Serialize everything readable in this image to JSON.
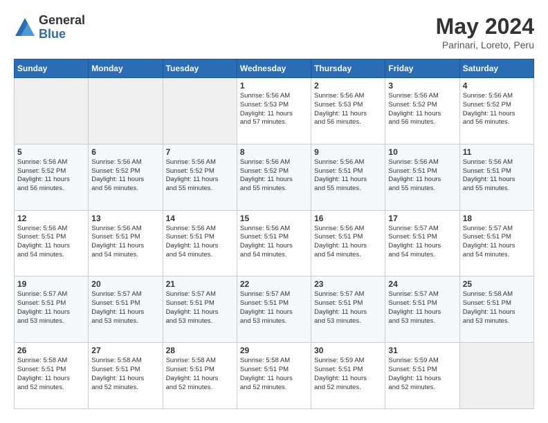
{
  "header": {
    "logo": {
      "general": "General",
      "blue": "Blue"
    },
    "title": "May 2024",
    "location": "Parinari, Loreto, Peru"
  },
  "days_of_week": [
    "Sunday",
    "Monday",
    "Tuesday",
    "Wednesday",
    "Thursday",
    "Friday",
    "Saturday"
  ],
  "weeks": [
    [
      {
        "day": "",
        "content": ""
      },
      {
        "day": "",
        "content": ""
      },
      {
        "day": "",
        "content": ""
      },
      {
        "day": "1",
        "content": "Sunrise: 5:56 AM\nSunset: 5:53 PM\nDaylight: 11 hours\nand 57 minutes."
      },
      {
        "day": "2",
        "content": "Sunrise: 5:56 AM\nSunset: 5:53 PM\nDaylight: 11 hours\nand 56 minutes."
      },
      {
        "day": "3",
        "content": "Sunrise: 5:56 AM\nSunset: 5:52 PM\nDaylight: 11 hours\nand 56 minutes."
      },
      {
        "day": "4",
        "content": "Sunrise: 5:56 AM\nSunset: 5:52 PM\nDaylight: 11 hours\nand 56 minutes."
      }
    ],
    [
      {
        "day": "5",
        "content": "Sunrise: 5:56 AM\nSunset: 5:52 PM\nDaylight: 11 hours\nand 56 minutes."
      },
      {
        "day": "6",
        "content": "Sunrise: 5:56 AM\nSunset: 5:52 PM\nDaylight: 11 hours\nand 56 minutes."
      },
      {
        "day": "7",
        "content": "Sunrise: 5:56 AM\nSunset: 5:52 PM\nDaylight: 11 hours\nand 55 minutes."
      },
      {
        "day": "8",
        "content": "Sunrise: 5:56 AM\nSunset: 5:52 PM\nDaylight: 11 hours\nand 55 minutes."
      },
      {
        "day": "9",
        "content": "Sunrise: 5:56 AM\nSunset: 5:51 PM\nDaylight: 11 hours\nand 55 minutes."
      },
      {
        "day": "10",
        "content": "Sunrise: 5:56 AM\nSunset: 5:51 PM\nDaylight: 11 hours\nand 55 minutes."
      },
      {
        "day": "11",
        "content": "Sunrise: 5:56 AM\nSunset: 5:51 PM\nDaylight: 11 hours\nand 55 minutes."
      }
    ],
    [
      {
        "day": "12",
        "content": "Sunrise: 5:56 AM\nSunset: 5:51 PM\nDaylight: 11 hours\nand 54 minutes."
      },
      {
        "day": "13",
        "content": "Sunrise: 5:56 AM\nSunset: 5:51 PM\nDaylight: 11 hours\nand 54 minutes."
      },
      {
        "day": "14",
        "content": "Sunrise: 5:56 AM\nSunset: 5:51 PM\nDaylight: 11 hours\nand 54 minutes."
      },
      {
        "day": "15",
        "content": "Sunrise: 5:56 AM\nSunset: 5:51 PM\nDaylight: 11 hours\nand 54 minutes."
      },
      {
        "day": "16",
        "content": "Sunrise: 5:56 AM\nSunset: 5:51 PM\nDaylight: 11 hours\nand 54 minutes."
      },
      {
        "day": "17",
        "content": "Sunrise: 5:57 AM\nSunset: 5:51 PM\nDaylight: 11 hours\nand 54 minutes."
      },
      {
        "day": "18",
        "content": "Sunrise: 5:57 AM\nSunset: 5:51 PM\nDaylight: 11 hours\nand 54 minutes."
      }
    ],
    [
      {
        "day": "19",
        "content": "Sunrise: 5:57 AM\nSunset: 5:51 PM\nDaylight: 11 hours\nand 53 minutes."
      },
      {
        "day": "20",
        "content": "Sunrise: 5:57 AM\nSunset: 5:51 PM\nDaylight: 11 hours\nand 53 minutes."
      },
      {
        "day": "21",
        "content": "Sunrise: 5:57 AM\nSunset: 5:51 PM\nDaylight: 11 hours\nand 53 minutes."
      },
      {
        "day": "22",
        "content": "Sunrise: 5:57 AM\nSunset: 5:51 PM\nDaylight: 11 hours\nand 53 minutes."
      },
      {
        "day": "23",
        "content": "Sunrise: 5:57 AM\nSunset: 5:51 PM\nDaylight: 11 hours\nand 53 minutes."
      },
      {
        "day": "24",
        "content": "Sunrise: 5:57 AM\nSunset: 5:51 PM\nDaylight: 11 hours\nand 53 minutes."
      },
      {
        "day": "25",
        "content": "Sunrise: 5:58 AM\nSunset: 5:51 PM\nDaylight: 11 hours\nand 53 minutes."
      }
    ],
    [
      {
        "day": "26",
        "content": "Sunrise: 5:58 AM\nSunset: 5:51 PM\nDaylight: 11 hours\nand 52 minutes."
      },
      {
        "day": "27",
        "content": "Sunrise: 5:58 AM\nSunset: 5:51 PM\nDaylight: 11 hours\nand 52 minutes."
      },
      {
        "day": "28",
        "content": "Sunrise: 5:58 AM\nSunset: 5:51 PM\nDaylight: 11 hours\nand 52 minutes."
      },
      {
        "day": "29",
        "content": "Sunrise: 5:58 AM\nSunset: 5:51 PM\nDaylight: 11 hours\nand 52 minutes."
      },
      {
        "day": "30",
        "content": "Sunrise: 5:59 AM\nSunset: 5:51 PM\nDaylight: 11 hours\nand 52 minutes."
      },
      {
        "day": "31",
        "content": "Sunrise: 5:59 AM\nSunset: 5:51 PM\nDaylight: 11 hours\nand 52 minutes."
      },
      {
        "day": "",
        "content": ""
      }
    ]
  ]
}
